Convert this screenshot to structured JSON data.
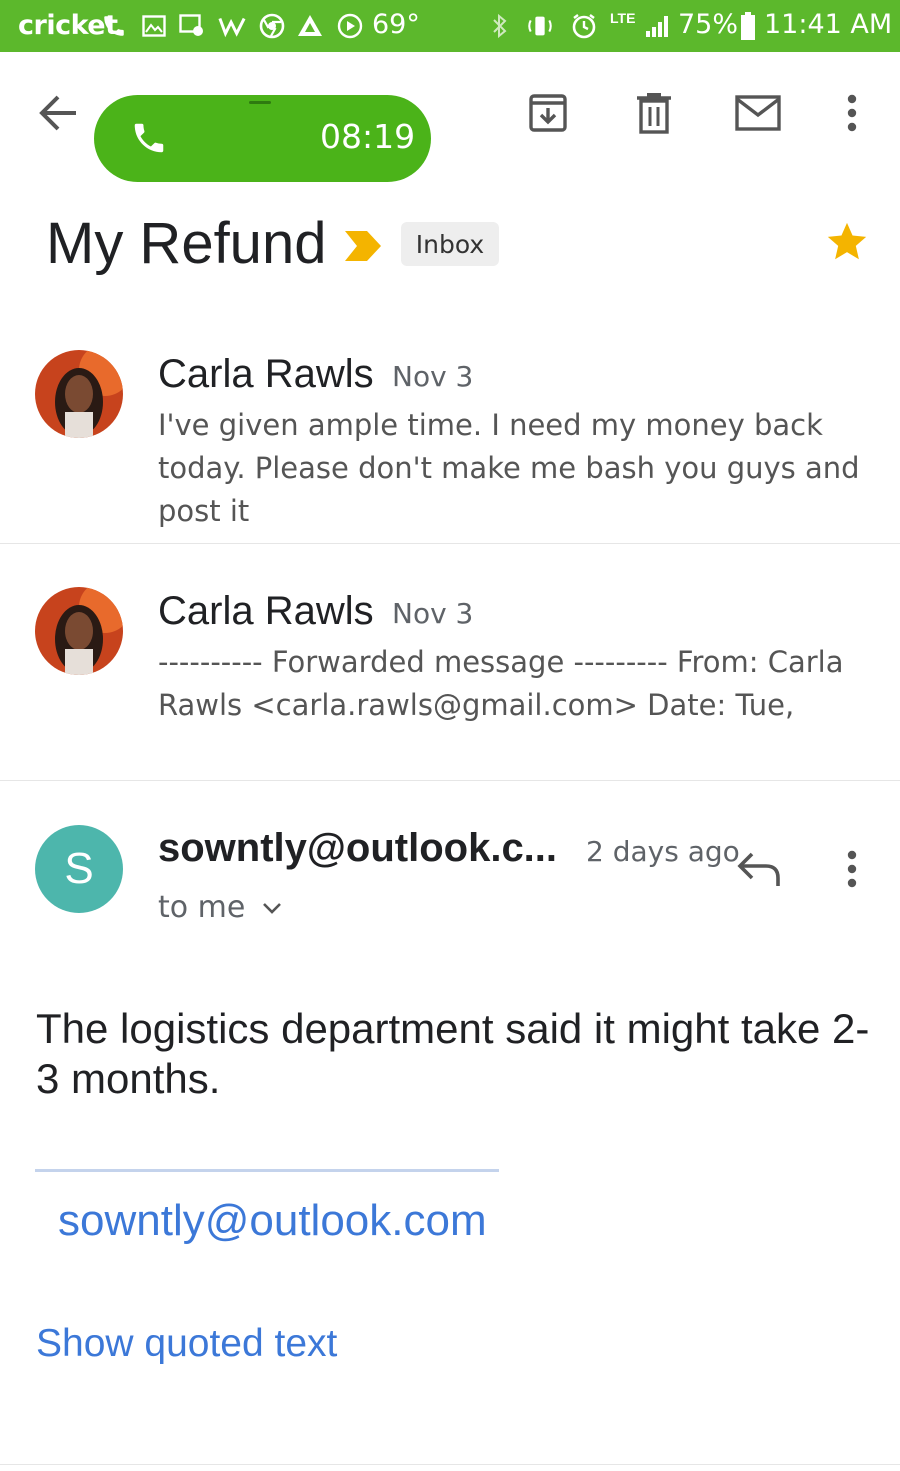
{
  "status_bar": {
    "carrier": "cricket",
    "temperature": "69°",
    "network": "LTE",
    "battery": "75%",
    "time": "11:41 AM",
    "bg_color": "#5cb82c"
  },
  "call_banner": {
    "timer": "08:19",
    "color": "#4bb319"
  },
  "toolbar": {
    "icons": [
      "back-arrow-icon",
      "archive-icon",
      "delete-icon",
      "mark-unread-icon",
      "more-vert-icon"
    ]
  },
  "subject": {
    "title": "My Refund",
    "label": "Inbox",
    "important_color": "#f4b400",
    "star_color": "#f4b400"
  },
  "messages": [
    {
      "sender": "Carla Rawls",
      "date": "Nov 3",
      "snippet": "I've given ample time. I need my money back today. Please don't make me bash you guys and post it"
    },
    {
      "sender": "Carla Rawls",
      "date": "Nov 3",
      "snippet": "---------- Forwarded message --------- From: Carla Rawls <carla.rawls@gmail.com> Date: Tue,"
    }
  ],
  "expanded_message": {
    "avatar_letter": "S",
    "avatar_color": "#4db6ac",
    "sender": "sowntly@outlook.c...",
    "date": "2 days ago",
    "recipient": "to me",
    "body": "The logistics department said it might take 2-3 months.",
    "signature_email": "sowntly@outlook.com",
    "show_quoted": "Show quoted text"
  }
}
